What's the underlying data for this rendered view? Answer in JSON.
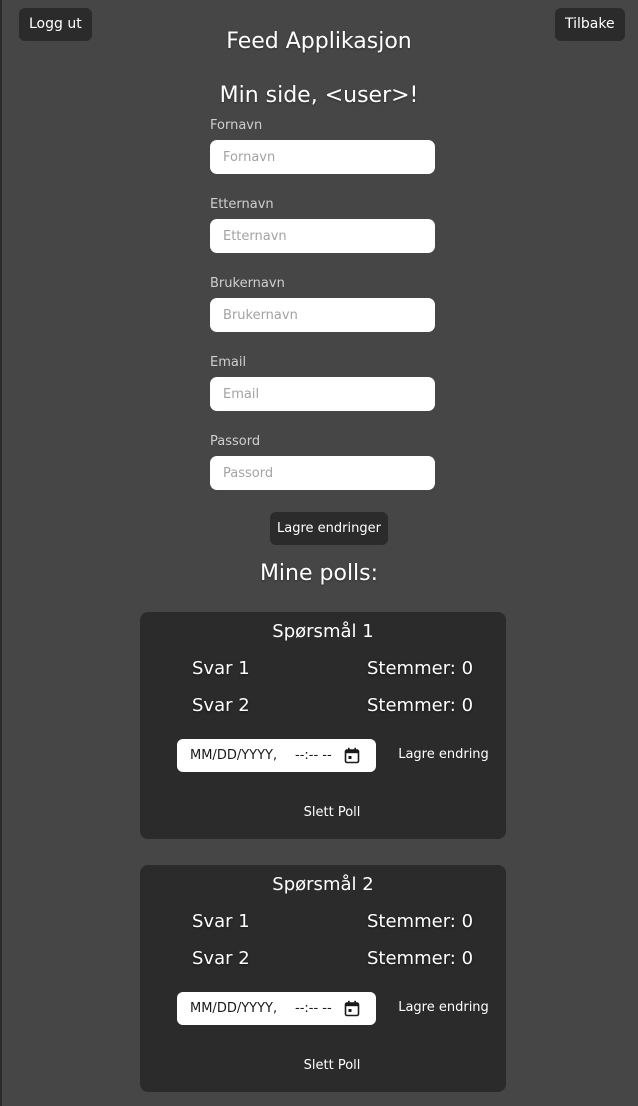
{
  "header": {
    "logout_label": "Logg ut",
    "back_label": "Tilbake",
    "app_title": "Feed Applikasjon",
    "page_title": "Min side, <user>!"
  },
  "profile_form": {
    "fields": [
      {
        "label": "Fornavn",
        "placeholder": "Fornavn"
      },
      {
        "label": "Etternavn",
        "placeholder": "Etternavn"
      },
      {
        "label": "Brukernavn",
        "placeholder": "Brukernavn"
      },
      {
        "label": "Email",
        "placeholder": "Email"
      },
      {
        "label": "Passord",
        "placeholder": "Passord"
      }
    ],
    "save_label": "Lagre endringer"
  },
  "polls_section": {
    "heading": "Mine polls:",
    "polls": [
      {
        "question": "Spørsmål 1",
        "answers": [
          {
            "label": "Svar 1",
            "votes": "Stemmer: 0"
          },
          {
            "label": "Svar 2",
            "votes": "Stemmer: 0"
          }
        ],
        "date_placeholder": "MM/DD/YYYY,",
        "time_placeholder": "--:-- --",
        "save_label": "Lagre endring",
        "delete_label": "Slett Poll"
      },
      {
        "question": "Spørsmål 2",
        "answers": [
          {
            "label": "Svar 1",
            "votes": "Stemmer: 0"
          },
          {
            "label": "Svar 2",
            "votes": "Stemmer: 0"
          }
        ],
        "date_placeholder": "MM/DD/YYYY,",
        "time_placeholder": "--:-- --",
        "save_label": "Lagre endring",
        "delete_label": "Slett Poll"
      }
    ]
  },
  "colors": {
    "background": "#464646",
    "card": "#2b2b2b",
    "button": "#2b2b2b",
    "input": "#ffffff"
  },
  "icons": {
    "calendar": "calendar-icon"
  }
}
